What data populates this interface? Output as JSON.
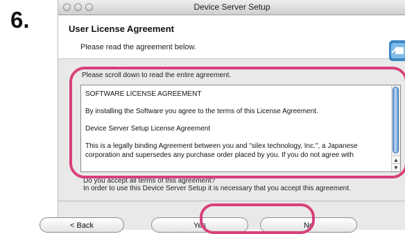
{
  "step_number": "6.",
  "window": {
    "title": "Device Server Setup"
  },
  "header": {
    "title": "User License Agreement",
    "subtitle": "Please read the agreement below."
  },
  "instruction": "Please scroll down to read the entire agreement.",
  "license": {
    "paragraphs": [
      "SOFTWARE LICENSE AGREEMENT",
      "By installing the Software you agree to the terms of this License Agreement.",
      "Device Server Setup License Agreement",
      "This is a legally binding Agreement between you and \"silex technology, Inc.\", a Japanese corporation and supersedes any purchase order placed by you.  If you do not agree with"
    ]
  },
  "question": {
    "line1": "Do you accept all terms of this agreement?",
    "line2": "In order to use this Device Server Setup it is necessary that you accept this agreement."
  },
  "buttons": {
    "back": "< Back",
    "yes": "Yes",
    "no": "No"
  },
  "colors": {
    "highlight": "#d8407a",
    "scroll_thumb": "#6da1d8"
  },
  "icons": {
    "setup": "setup-app-icon",
    "scroll_up": "scroll-up-arrow-icon",
    "scroll_down": "scroll-down-arrow-icon"
  }
}
